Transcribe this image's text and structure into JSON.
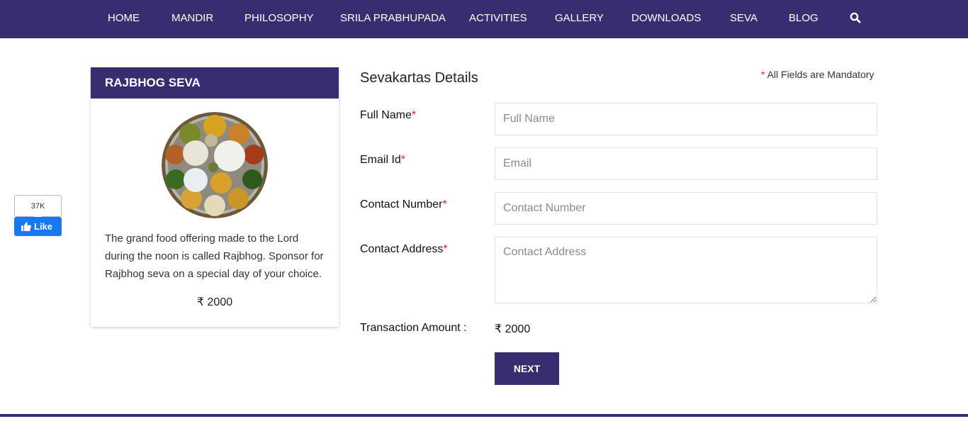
{
  "nav": {
    "items": [
      {
        "label": "HOME"
      },
      {
        "label": "MANDIR"
      },
      {
        "label": "PHILOSOPHY"
      },
      {
        "label": "SRILA PRABHUPADA"
      },
      {
        "label": "ACTIVITIES"
      },
      {
        "label": "GALLERY"
      },
      {
        "label": "DOWNLOADS"
      },
      {
        "label": "SEVA"
      },
      {
        "label": "BLOG"
      }
    ],
    "search_icon": "search-icon"
  },
  "colors": {
    "brand": "#372e72",
    "required": "#e0252f",
    "facebook": "#1877f2"
  },
  "fb": {
    "count": "37K",
    "like_label": "Like"
  },
  "seva_card": {
    "title": "RAJBHOG SEVA",
    "description": "The grand food offering made to the Lord during the noon is called Rajbhog. Sponsor for Rajbhog seva on a special day of your choice.",
    "price": "₹ 2000"
  },
  "form": {
    "title": "Sevakartas Details",
    "mandatory_star": "*",
    "mandatory_text": " All Fields are Mandatory",
    "required_mark": "*",
    "fields": [
      {
        "label": "Full Name",
        "placeholder": "Full Name",
        "value": ""
      },
      {
        "label": "Email Id",
        "placeholder": "Email",
        "value": ""
      },
      {
        "label": "Contact Number",
        "placeholder": "Contact Number",
        "value": ""
      },
      {
        "label": "Contact Address",
        "placeholder": "Contact Address",
        "value": ""
      }
    ],
    "amount_label": "Transaction Amount :",
    "amount_value": "₹ 2000",
    "next_label": "NEXT"
  }
}
